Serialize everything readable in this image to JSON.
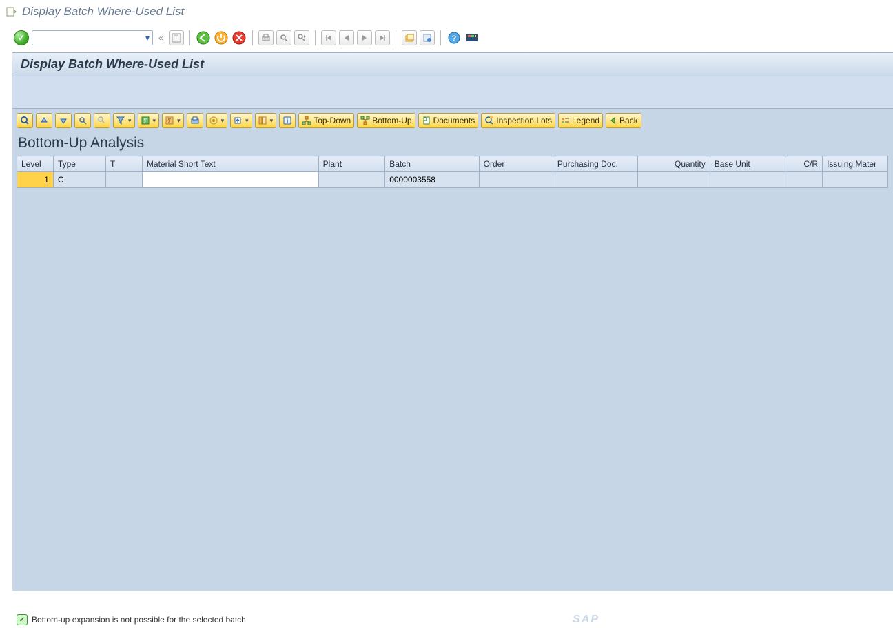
{
  "window": {
    "title": "Display Batch Where-Used List"
  },
  "page": {
    "title": "Display Batch Where-Used List"
  },
  "appbar": {
    "top_down": "Top-Down",
    "bottom_up": "Bottom-Up",
    "documents": "Documents",
    "inspection_lots": "Inspection Lots",
    "legend": "Legend",
    "back": "Back"
  },
  "section": {
    "heading": "Bottom-Up Analysis"
  },
  "columns": {
    "level": "Level",
    "type": "Type",
    "t": "T",
    "mst": "Material Short Text",
    "plant": "Plant",
    "batch": "Batch",
    "order": "Order",
    "pdoc": "Purchasing Doc.",
    "qty": "Quantity",
    "bu": "Base Unit",
    "cr": "C/R",
    "im": "Issuing Mater"
  },
  "rows": [
    {
      "level": "1",
      "type": "C",
      "t": "",
      "mst": "",
      "plant": "",
      "batch": "0000003558",
      "order": "",
      "pdoc": "",
      "qty": "",
      "bu": "",
      "cr": "",
      "im": ""
    }
  ],
  "status": {
    "message": "Bottom-up expansion is not possible for the selected batch"
  },
  "logo": {
    "text": "SAP"
  }
}
